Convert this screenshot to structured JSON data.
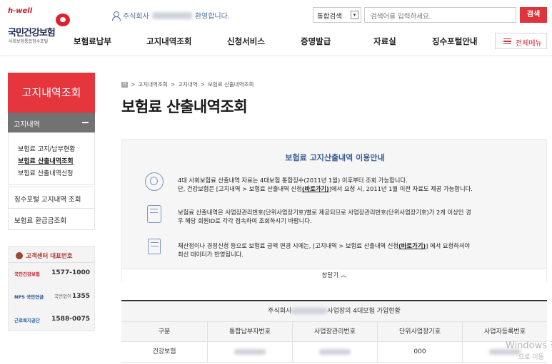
{
  "header": {
    "logo": {
      "hwell": "h-well",
      "name": "국민건강보험",
      "sub": "사회보험통합징수포털"
    },
    "welcome": {
      "prefix": "주식회사",
      "suffix": "환영합니다."
    },
    "search": {
      "scope": "통합검색",
      "caret": "▾",
      "placeholder": "검색어를 입력하세요.",
      "button": "검색"
    },
    "gnb": [
      "보험료납부",
      "고지내역조회",
      "신청서비스",
      "증명발급",
      "자료실",
      "징수포털안내"
    ],
    "all_menu": "전체메뉴"
  },
  "sidebar": {
    "title": "고지내역조회",
    "section": "고지내역",
    "items": [
      "보험료 고지/납부현황",
      "보험료 산출내역조회",
      "보험료 산출내역신청"
    ],
    "links": [
      "징수포털 고지내역 조회",
      "보험료 환급금조회"
    ],
    "customer_center": {
      "title": "고객센터 대표번호",
      "rows": [
        {
          "org": "국민건강보험",
          "prefix": "",
          "number": "1577-1000"
        },
        {
          "org": "NPS 국민연금",
          "prefix": "국번없이",
          "number": "1355"
        },
        {
          "org": "근로복지공단",
          "prefix": "",
          "number": "1588-0075"
        }
      ]
    }
  },
  "main": {
    "breadcrumb": [
      "고지내역조회",
      "고지내역",
      "보험료 산출내역조회"
    ],
    "home": "H",
    "title": "보험료 산출내역조회",
    "guide": {
      "title": "보험료 고지산출내역 이용안내",
      "item1_line1": "4대 사회보험료 산출내역 자료는 4대보험 통합징수(2011년 1월) 이후부터 조회 가능합니다.",
      "item1_line2_pre": "단, 건강보험은 [고지내역 > 보험료 산출내역 신청",
      "item1_link": "(바로가기)",
      "item1_line2_post": "]에서 요청 시, 2011년 1월 이전 자료도 제공 가능합니다.",
      "item2_line1": "보험료 산출내역은 사업장관리번호(단위사업장기호)별로 제공되므로 사업장관리번호(단위사업장기호)가 2개 이상인 경",
      "item2_line2": "우 해당 회원ID로 각각 접속하여 조회하시기 바랍니다.",
      "item3_line1_pre": "재산정이나 경정신청 등으로 보험료 금액 변경 시에는, [고지내역 > 보험료 산출내역 신청",
      "item3_link": "(바로가기)",
      "item3_line1_post": "] 에서 요청하셔야",
      "item3_line2": "최신 데이터가 반영됩니다.",
      "close": "창닫기 ︿"
    },
    "table": {
      "caption_prefix": "주식회사",
      "caption_suffix": "사업장의 4대보험 가입현황",
      "headers": [
        "구분",
        "통합납부자번호",
        "사업장관리번호",
        "단위사업장기호",
        "사업자등록번호"
      ],
      "rows": [
        {
          "label": "건강보험",
          "unit_code": "000"
        }
      ]
    }
  },
  "watermark": {
    "title": "Windows 정",
    "sub": "으로 이동"
  }
}
